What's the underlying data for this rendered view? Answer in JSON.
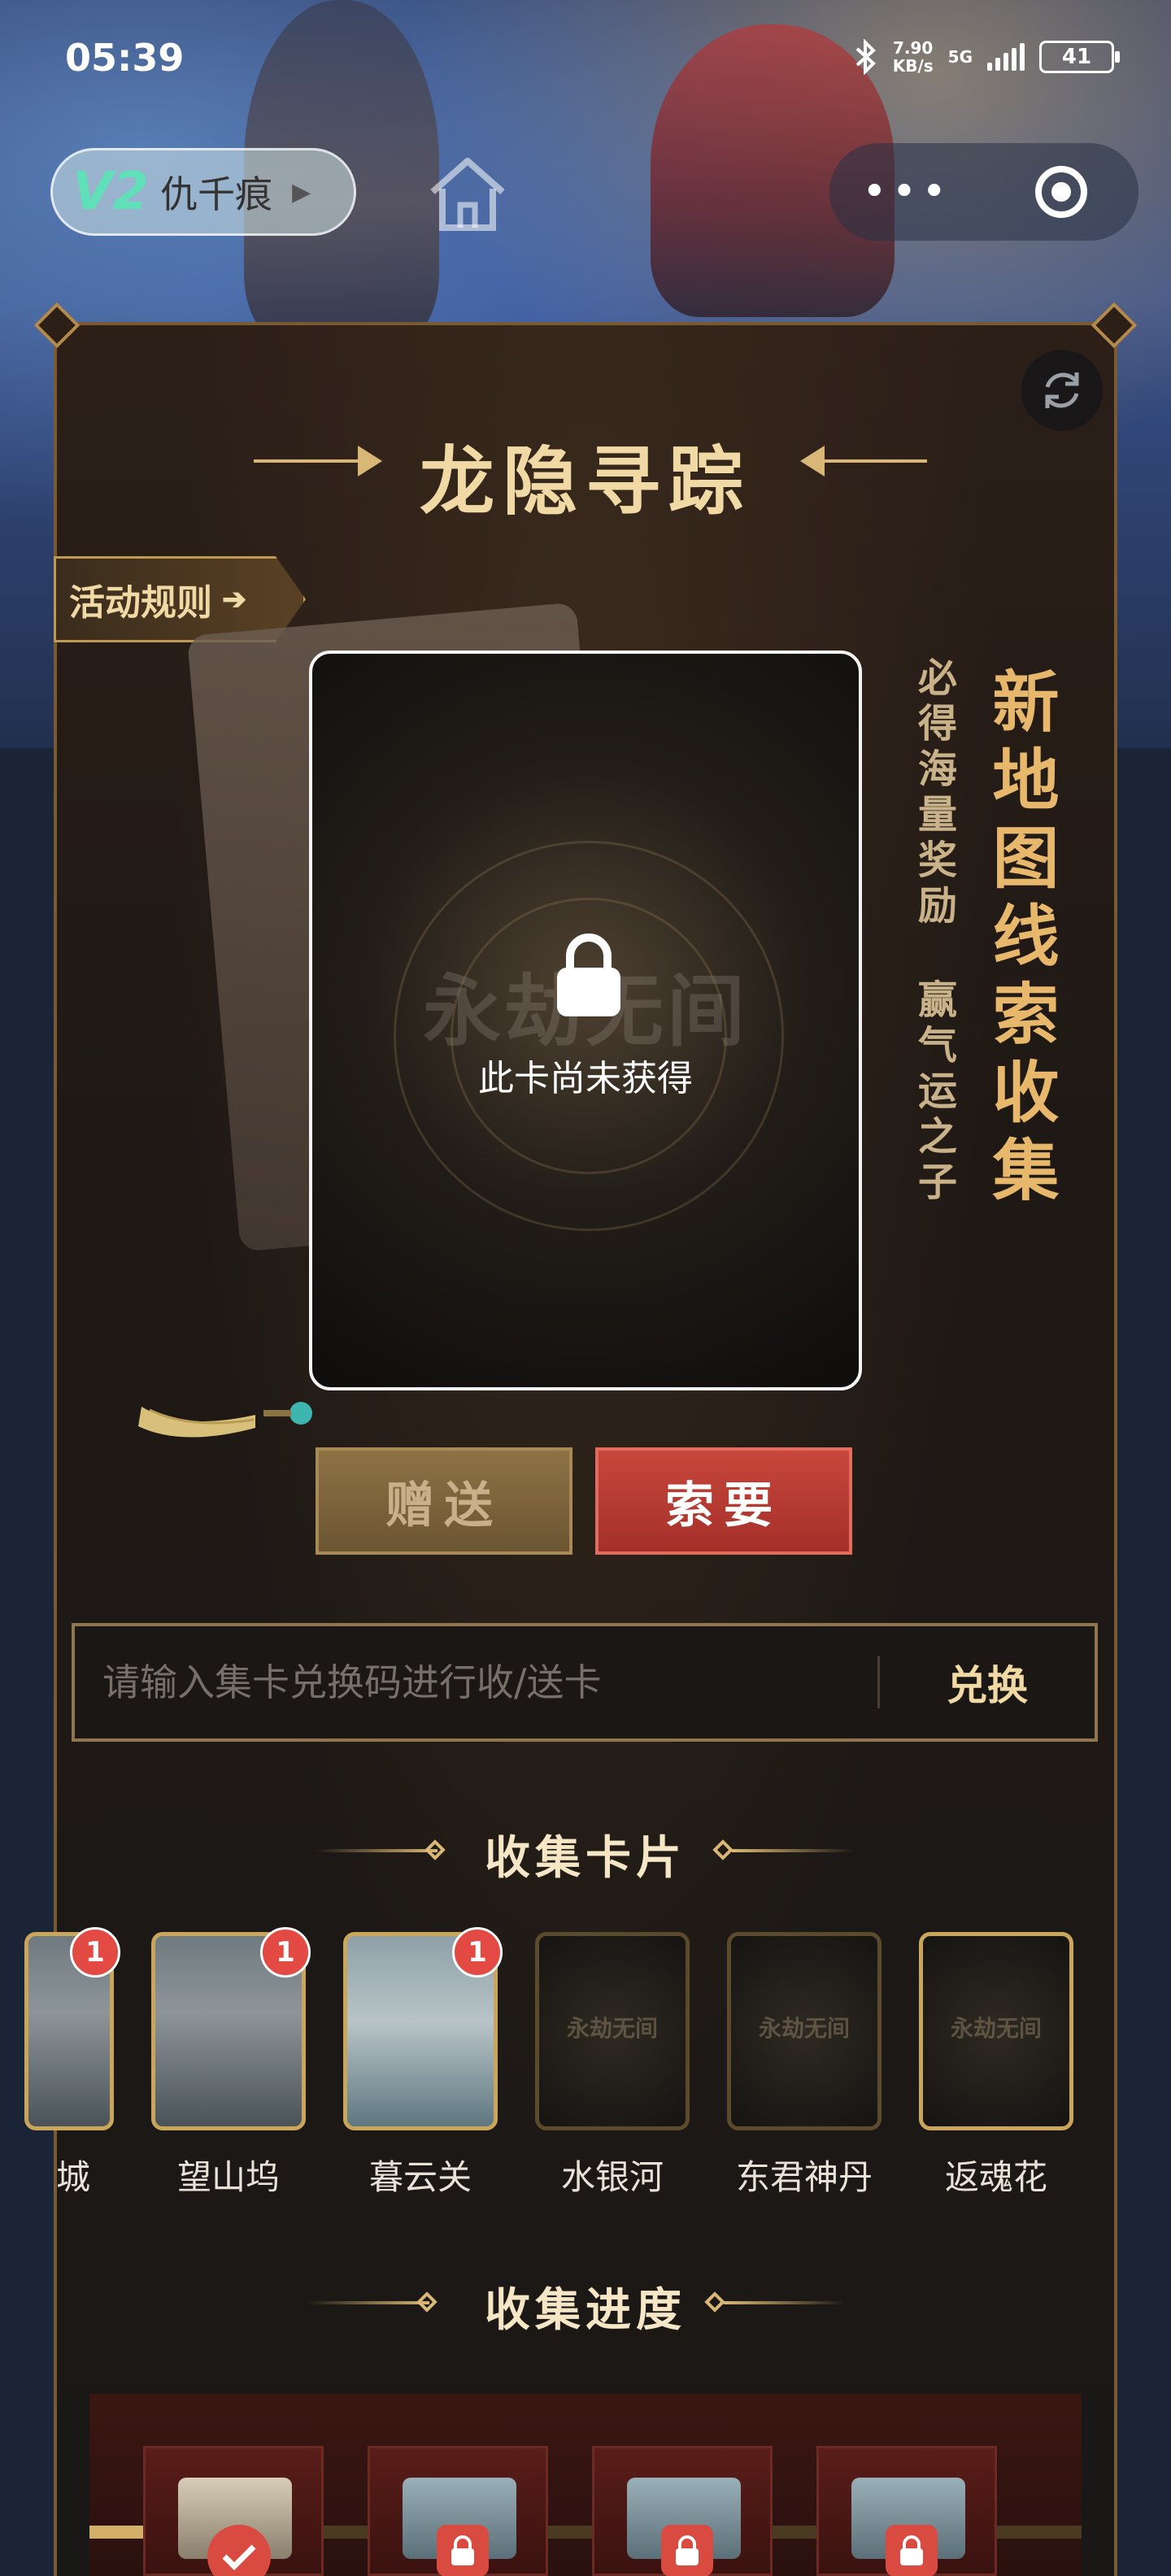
{
  "status_bar": {
    "time": "05:39",
    "net_speed": "7.90",
    "net_unit": "KB/s",
    "network": "5G",
    "battery": "41"
  },
  "top_bar": {
    "user_badge": "V2",
    "user_name": "仇千痕"
  },
  "header": {
    "title": "龙隐寻踪",
    "rules_label": "活动规则"
  },
  "card": {
    "lock_text": "此卡尚未获得",
    "watermark": "永劫无间"
  },
  "slogan": {
    "small_line1": "必得海量奖励",
    "small_line2": "赢气运之子",
    "big": "新地图线索收集"
  },
  "actions": {
    "gift_label": "赠送",
    "ask_label": "索要"
  },
  "redeem": {
    "placeholder": "请输入集卡兑换码进行收/送卡",
    "button_label": "兑换"
  },
  "collect": {
    "title": "收集卡片",
    "cards": [
      {
        "label": "城",
        "count": "1",
        "owned": true
      },
      {
        "label": "望山坞",
        "count": "1",
        "owned": true
      },
      {
        "label": "暮云关",
        "count": "1",
        "owned": true
      },
      {
        "label": "水银河",
        "owned": false
      },
      {
        "label": "东君神丹",
        "owned": false
      },
      {
        "label": "返魂花",
        "owned": false
      }
    ]
  },
  "progress": {
    "title": "收集进度",
    "rewards": [
      {
        "state": "claimed"
      },
      {
        "state": "locked"
      },
      {
        "state": "locked"
      },
      {
        "state": "locked"
      }
    ],
    "fill_fraction": 0.18
  },
  "colors": {
    "accent_gold": "#d8b777",
    "ask_red": "#c8463b",
    "badge_red": "#e24a43"
  }
}
